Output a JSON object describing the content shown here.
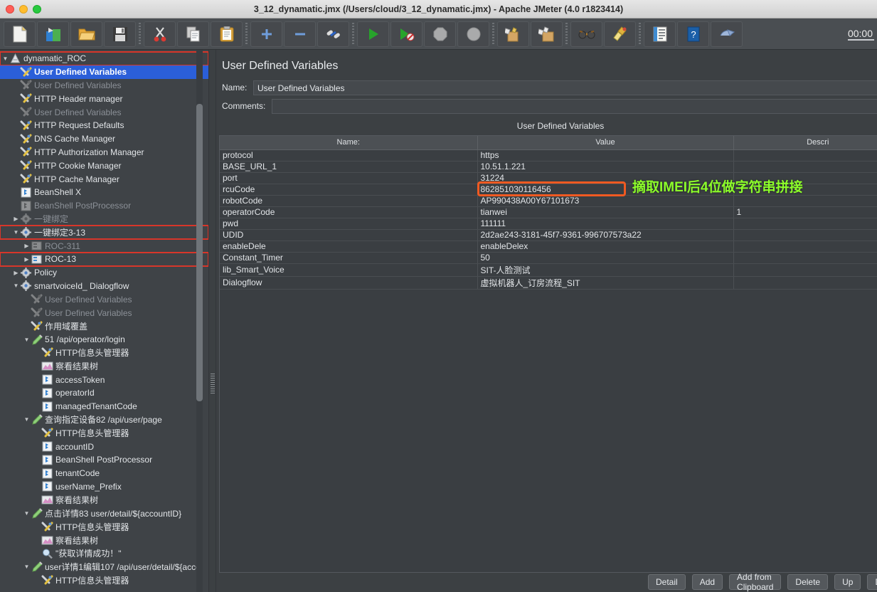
{
  "window": {
    "title": "3_12_dynamatic.jmx (/Users/cloud/3_12_dynamatic.jmx) - Apache JMeter (4.0 r1823414)"
  },
  "toolbar": {
    "timer": "00:00",
    "buttons": [
      {
        "name": "new-icon",
        "tip": "New"
      },
      {
        "name": "templates-icon",
        "tip": "Templates"
      },
      {
        "name": "open-icon",
        "tip": "Open"
      },
      {
        "name": "save-icon",
        "tip": "Save"
      },
      {
        "name": "cut-icon",
        "tip": "Cut"
      },
      {
        "name": "copy-icon",
        "tip": "Copy"
      },
      {
        "name": "paste-icon",
        "tip": "Paste"
      },
      {
        "name": "expand-icon",
        "tip": "Expand All"
      },
      {
        "name": "collapse-icon",
        "tip": "Collapse All"
      },
      {
        "name": "toggle-icon",
        "tip": "Toggle"
      },
      {
        "name": "start-icon",
        "tip": "Start"
      },
      {
        "name": "start-no-pauses-icon",
        "tip": "Start no pauses"
      },
      {
        "name": "stop-icon",
        "tip": "Stop"
      },
      {
        "name": "shutdown-icon",
        "tip": "Shutdown"
      },
      {
        "name": "clear-icon",
        "tip": "Clear"
      },
      {
        "name": "clear-all-icon",
        "tip": "Clear All"
      },
      {
        "name": "search-icon",
        "tip": "Search"
      },
      {
        "name": "reset-search-icon",
        "tip": "Reset Search"
      },
      {
        "name": "function-helper-icon",
        "tip": "Function Helper Dialog"
      },
      {
        "name": "help-icon",
        "tip": "Help"
      },
      {
        "name": "undo-icon",
        "tip": "Undo"
      }
    ]
  },
  "tree": {
    "nodes": [
      {
        "label": "dynamatic_ROC",
        "indent": 0,
        "icon": "plan",
        "twist": "down",
        "dim": false,
        "sel": false,
        "box": true
      },
      {
        "label": "User Defined Variables",
        "indent": 1,
        "icon": "wrench",
        "twist": "none",
        "dim": false,
        "sel": true,
        "box": false
      },
      {
        "label": "User Defined Variables",
        "indent": 1,
        "icon": "wrench",
        "twist": "none",
        "dim": true,
        "sel": false,
        "box": false
      },
      {
        "label": "HTTP Header manager",
        "indent": 1,
        "icon": "wrench",
        "twist": "none",
        "dim": false,
        "sel": false,
        "box": false
      },
      {
        "label": "User Defined Variables",
        "indent": 1,
        "icon": "wrench",
        "twist": "none",
        "dim": true,
        "sel": false,
        "box": false
      },
      {
        "label": "HTTP Request Defaults",
        "indent": 1,
        "icon": "wrench",
        "twist": "none",
        "dim": false,
        "sel": false,
        "box": false
      },
      {
        "label": "DNS Cache Manager",
        "indent": 1,
        "icon": "wrench",
        "twist": "none",
        "dim": false,
        "sel": false,
        "box": false
      },
      {
        "label": "HTTP Authorization Manager",
        "indent": 1,
        "icon": "wrench",
        "twist": "none",
        "dim": false,
        "sel": false,
        "box": false
      },
      {
        "label": "HTTP Cookie Manager",
        "indent": 1,
        "icon": "wrench",
        "twist": "none",
        "dim": false,
        "sel": false,
        "box": false
      },
      {
        "label": "HTTP Cache Manager",
        "indent": 1,
        "icon": "wrench",
        "twist": "none",
        "dim": false,
        "sel": false,
        "box": false
      },
      {
        "label": "BeanShell X",
        "indent": 1,
        "icon": "bean",
        "twist": "none",
        "dim": false,
        "sel": false,
        "box": false
      },
      {
        "label": "BeanShell PostProcessor",
        "indent": 1,
        "icon": "bean",
        "twist": "none",
        "dim": true,
        "sel": false,
        "box": false
      },
      {
        "label": "一键绑定",
        "indent": 1,
        "icon": "gear",
        "twist": "right",
        "dim": true,
        "sel": false,
        "box": false
      },
      {
        "label": "一键绑定3-13",
        "indent": 1,
        "icon": "gear",
        "twist": "down",
        "dim": false,
        "sel": false,
        "box": true
      },
      {
        "label": "ROC-311",
        "indent": 2,
        "icon": "ctrl",
        "twist": "right",
        "dim": true,
        "sel": false,
        "box": false
      },
      {
        "label": "ROC-13",
        "indent": 2,
        "icon": "ctrl",
        "twist": "right",
        "dim": false,
        "sel": false,
        "box": true
      },
      {
        "label": "Policy",
        "indent": 1,
        "icon": "gear",
        "twist": "right",
        "dim": false,
        "sel": false,
        "box": false
      },
      {
        "label": "smartvoiceId_ Dialogflow",
        "indent": 1,
        "icon": "gear",
        "twist": "down",
        "dim": false,
        "sel": false,
        "box": false
      },
      {
        "label": "User Defined Variables",
        "indent": 2,
        "icon": "wrench",
        "twist": "none",
        "dim": true,
        "sel": false,
        "box": false
      },
      {
        "label": "User Defined Variables",
        "indent": 2,
        "icon": "wrench",
        "twist": "none",
        "dim": true,
        "sel": false,
        "box": false
      },
      {
        "label": "作用域覆盖",
        "indent": 2,
        "icon": "wrench",
        "twist": "none",
        "dim": false,
        "sel": false,
        "box": false
      },
      {
        "label": "51 /api/operator/login",
        "indent": 2,
        "icon": "sampler",
        "twist": "down",
        "dim": false,
        "sel": false,
        "box": false
      },
      {
        "label": "HTTP信息头管理器",
        "indent": 3,
        "icon": "wrench",
        "twist": "none",
        "dim": false,
        "sel": false,
        "box": false
      },
      {
        "label": "察看结果树",
        "indent": 3,
        "icon": "listener",
        "twist": "none",
        "dim": false,
        "sel": false,
        "box": false
      },
      {
        "label": "accessToken",
        "indent": 3,
        "icon": "bean",
        "twist": "none",
        "dim": false,
        "sel": false,
        "box": false
      },
      {
        "label": "operatorId",
        "indent": 3,
        "icon": "bean",
        "twist": "none",
        "dim": false,
        "sel": false,
        "box": false
      },
      {
        "label": "managedTenantCode",
        "indent": 3,
        "icon": "bean",
        "twist": "none",
        "dim": false,
        "sel": false,
        "box": false
      },
      {
        "label": "查询指定设备82 /api/user/page",
        "indent": 2,
        "icon": "sampler",
        "twist": "down",
        "dim": false,
        "sel": false,
        "box": false
      },
      {
        "label": "HTTP信息头管理器",
        "indent": 3,
        "icon": "wrench",
        "twist": "none",
        "dim": false,
        "sel": false,
        "box": false
      },
      {
        "label": "accountID",
        "indent": 3,
        "icon": "bean",
        "twist": "none",
        "dim": false,
        "sel": false,
        "box": false
      },
      {
        "label": "BeanShell PostProcessor",
        "indent": 3,
        "icon": "bean",
        "twist": "none",
        "dim": false,
        "sel": false,
        "box": false
      },
      {
        "label": "tenantCode",
        "indent": 3,
        "icon": "bean",
        "twist": "none",
        "dim": false,
        "sel": false,
        "box": false
      },
      {
        "label": "userName_Prefix",
        "indent": 3,
        "icon": "bean",
        "twist": "none",
        "dim": false,
        "sel": false,
        "box": false
      },
      {
        "label": "察看结果树",
        "indent": 3,
        "icon": "listener",
        "twist": "none",
        "dim": false,
        "sel": false,
        "box": false
      },
      {
        "label": "点击详情83 user/detail/${accountID}",
        "indent": 2,
        "icon": "sampler",
        "twist": "down",
        "dim": false,
        "sel": false,
        "box": false
      },
      {
        "label": "HTTP信息头管理器",
        "indent": 3,
        "icon": "wrench",
        "twist": "none",
        "dim": false,
        "sel": false,
        "box": false
      },
      {
        "label": "察看结果树",
        "indent": 3,
        "icon": "listener",
        "twist": "none",
        "dim": false,
        "sel": false,
        "box": false
      },
      {
        "label": "\"获取详情成功！\"",
        "indent": 3,
        "icon": "assert",
        "twist": "none",
        "dim": false,
        "sel": false,
        "box": false
      },
      {
        "label": "user详情1编辑107 /api/user/detail/${acco",
        "indent": 2,
        "icon": "sampler",
        "twist": "down",
        "dim": false,
        "sel": false,
        "box": false
      },
      {
        "label": "HTTP信息头管理器",
        "indent": 3,
        "icon": "wrench",
        "twist": "none",
        "dim": false,
        "sel": false,
        "box": false
      }
    ]
  },
  "panel": {
    "title": "User Defined Variables",
    "name_label": "Name:",
    "name_value": "User Defined Variables",
    "comments_label": "Comments:",
    "comments_value": "",
    "table_caption": "User Defined Variables",
    "columns": [
      "Name:",
      "Value",
      "Descri"
    ],
    "rows": [
      {
        "name": "protocol",
        "value": "https",
        "desc": ""
      },
      {
        "name": "BASE_URL_1",
        "value": "10.51.1.221",
        "desc": ""
      },
      {
        "name": "port",
        "value": "31224",
        "desc": ""
      },
      {
        "name": "rcuCode",
        "value": "862851030116456",
        "desc": ""
      },
      {
        "name": "robotCode",
        "value": "AP990438A00Y67101673",
        "desc": ""
      },
      {
        "name": "operatorCode",
        "value": "tianwei",
        "desc": "1"
      },
      {
        "name": "pwd",
        "value": "111111",
        "desc": ""
      },
      {
        "name": "UDID",
        "value": "2d2ae243-3181-45f7-9361-996707573a22",
        "desc": ""
      },
      {
        "name": "enableDele",
        "value": "enableDelex",
        "desc": ""
      },
      {
        "name": "Constant_Timer",
        "value": "50",
        "desc": ""
      },
      {
        "name": "lib_Smart_Voice",
        "value": "SIT-人脸测试",
        "desc": ""
      },
      {
        "name": "Dialogflow",
        "value": "虚拟机器人_订房流程_SIT",
        "desc": ""
      }
    ],
    "annotation": "摘取IMEI后4位做字符串拼接",
    "annotation_color": "#8dff2a",
    "highlight_color": "#f05a22",
    "buttons": [
      "Detail",
      "Add",
      "Add from Clipboard",
      "Delete",
      "Up",
      "Down"
    ]
  }
}
